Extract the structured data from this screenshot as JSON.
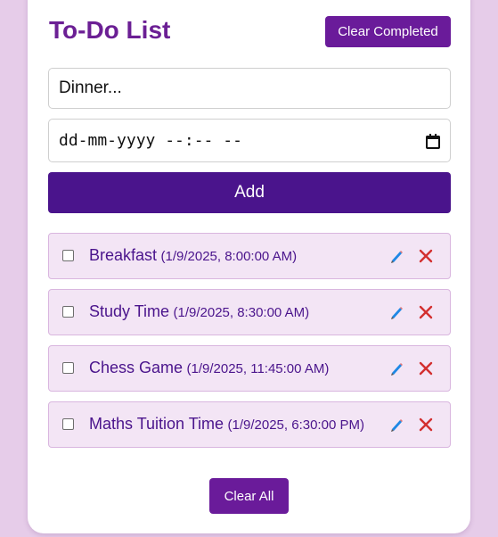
{
  "app": {
    "title": "To-Do List",
    "clear_completed_label": "Clear Completed",
    "clear_all_label": "Clear All"
  },
  "form": {
    "task_value": "Dinner...",
    "date_placeholder": "dd-mm-yyyy --:-- --",
    "add_label": "Add"
  },
  "tasks": [
    {
      "name": "Breakfast",
      "time": "(1/9/2025, 8:00:00 AM)",
      "completed": false
    },
    {
      "name": "Study Time",
      "time": "(1/9/2025, 8:30:00 AM)",
      "completed": false
    },
    {
      "name": "Chess Game",
      "time": "(1/9/2025, 11:45:00 AM)",
      "completed": false
    },
    {
      "name": "Maths Tuition Time",
      "time": "(1/9/2025, 6:30:00 PM)",
      "completed": false
    }
  ],
  "icons": {
    "edit": "pencil-icon",
    "delete": "close-icon",
    "calendar": "calendar-icon"
  },
  "colors": {
    "accent": "#6a1b9a",
    "add_button": "#4a148c",
    "item_bg": "#f3e5f5",
    "page_bg": "#e6cce9",
    "delete": "#d32f2f",
    "edit": "#1e88e5"
  }
}
